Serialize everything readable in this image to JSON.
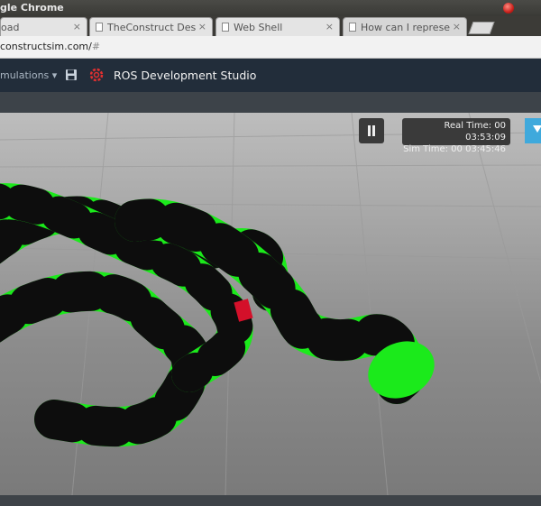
{
  "window": {
    "title": "gle Chrome"
  },
  "tabs": [
    {
      "label": "oad",
      "has_close": true
    },
    {
      "label": "TheConstruct Des",
      "has_close": true
    },
    {
      "label": "Web Shell",
      "has_close": true
    },
    {
      "label": "How can I represe",
      "has_close": true
    }
  ],
  "tab_close_glyph": "×",
  "address": {
    "url": "constructsim.com/",
    "hash": "#"
  },
  "appbar": {
    "simulations_menu": "mulations ▾",
    "save_icon": "floppy-disk-icon",
    "gear_icon": "gear-icon",
    "app_title": "ROS Development Studio"
  },
  "sim": {
    "real_time": "Real Time: 00 03:53:09",
    "sim_time": "Sim Time: 00 03:45:46",
    "pause_icon": "pause-icon"
  },
  "colors": {
    "snake_green": "#22ee22",
    "snake_black": "#111111",
    "nav_bg": "#222d3a",
    "accent_blue": "#3fa9dc"
  }
}
